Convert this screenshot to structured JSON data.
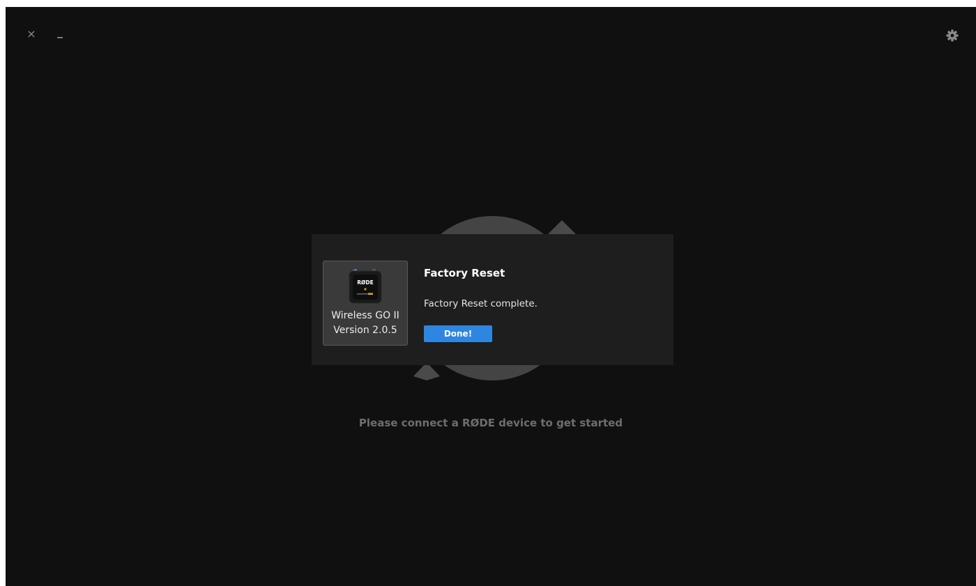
{
  "window": {
    "close_glyph": "×",
    "minimize_icon": "minimize-icon",
    "settings_icon": "gear-icon"
  },
  "background": {
    "connect_message": "Please connect a RØDE device to get started"
  },
  "dialog": {
    "title": "Factory Reset",
    "message": "Factory Reset complete.",
    "done_label": "Done!",
    "device": {
      "logo_text": "RØDE",
      "name": "Wireless GO II",
      "version": "Version 2.0.5"
    }
  },
  "colors": {
    "background": "#101010",
    "dialog": "#1e1e1e",
    "device_card": "#3a3a3a",
    "accent": "#2f86e1",
    "graphic": "#444444"
  }
}
